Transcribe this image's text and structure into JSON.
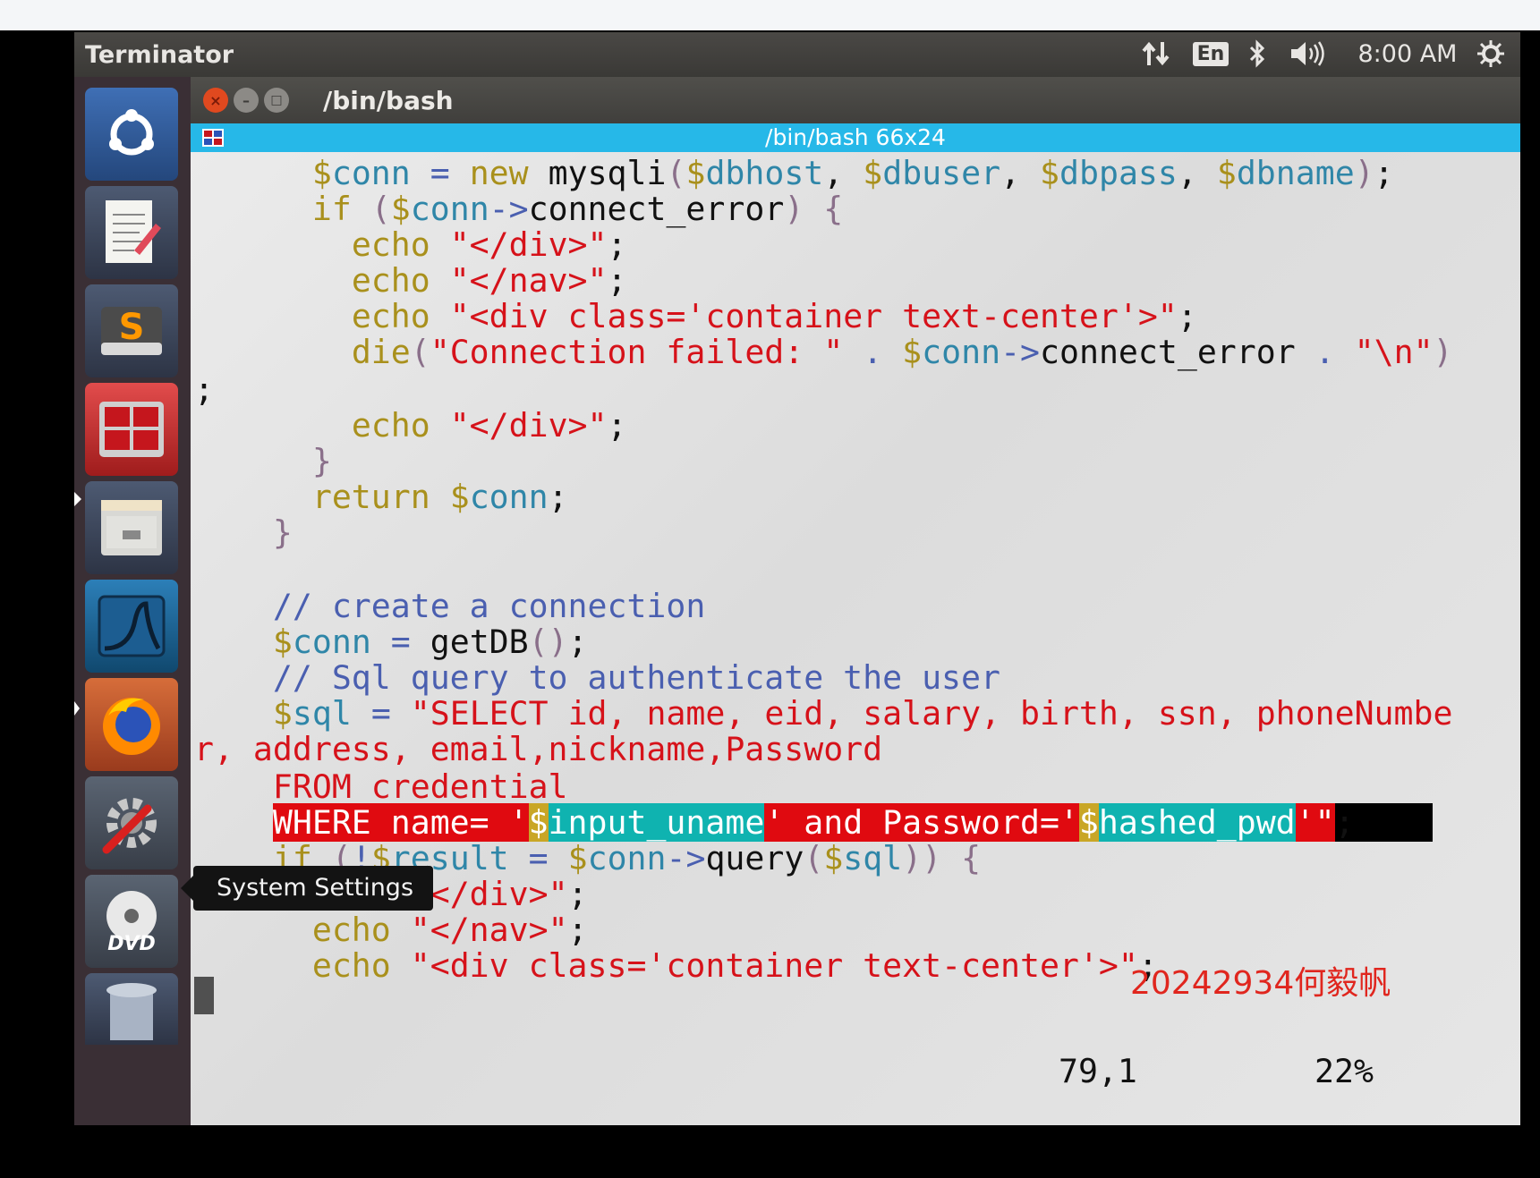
{
  "panel": {
    "app_title": "Terminator",
    "keyboard_layout": "En",
    "clock": "8:00 AM",
    "icons": [
      "network-icon",
      "keyboard-indicator",
      "bluetooth-icon",
      "volume-icon",
      "settings-gear-icon"
    ]
  },
  "launcher": {
    "items": [
      "ubuntu-dash",
      "text-editor",
      "sublime-text",
      "terminator",
      "file-manager",
      "wireshark",
      "firefox",
      "system-settings",
      "dvd",
      "trash"
    ],
    "tooltip": "System Settings"
  },
  "window": {
    "title": "/bin/bash",
    "tab_title": "/bin/bash 66x24"
  },
  "code_lines": [
    "      $conn = new mysqli($dbhost, $dbuser, $dbpass, $dbname);",
    "      if ($conn->connect_error) {",
    "        echo \"</div>\";",
    "        echo \"</nav>\";",
    "        echo \"<div class='container text-center'>\";",
    "        die(\"Connection failed: \" . $conn->connect_error . \"\\n\")",
    ";",
    "        echo \"</div>\";",
    "      }",
    "      return $conn;",
    "    }",
    "",
    "    // create a connection",
    "    $conn = getDB();",
    "    // Sql query to authenticate the user",
    "    $sql = \"SELECT id, name, eid, salary, birth, ssn, phoneNumbe",
    "r, address, email,nickname,Password",
    "    FROM credential",
    "    WHERE name= '$input_uname' and Password='$hashed_pwd'\";",
    "    if (!$result = $conn->query($sql)) {",
    "      echo \"</div>\";",
    "      echo \"</nav>\";",
    "      echo \"<div class='container text-center'>\";"
  ],
  "status": {
    "position": "79,1",
    "percent": "22%"
  },
  "watermark": "20242934何毅帆"
}
